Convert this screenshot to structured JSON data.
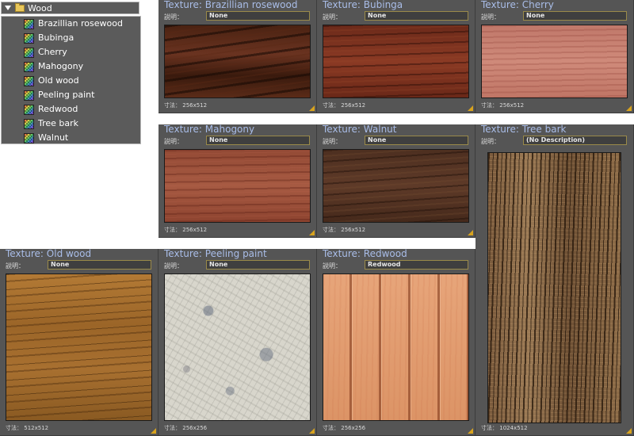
{
  "inventory": {
    "folder_label": "Wood",
    "items": [
      {
        "label": "Brazillian rosewood"
      },
      {
        "label": "Bubinga"
      },
      {
        "label": "Cherry"
      },
      {
        "label": "Mahogony"
      },
      {
        "label": "Old wood"
      },
      {
        "label": "Peeling paint"
      },
      {
        "label": "Redwood"
      },
      {
        "label": "Tree bark"
      },
      {
        "label": "Walnut"
      }
    ]
  },
  "desc_label": "説明：",
  "size_label": "寸法：",
  "panels": [
    {
      "title": "Texture: Brazillian rosewood",
      "description": "None",
      "size": "256x512"
    },
    {
      "title": "Texture: Bubinga",
      "description": "None",
      "size": "256x512"
    },
    {
      "title": "Texture: Cherry",
      "description": "None",
      "size": "256x512"
    },
    {
      "title": "Texture: Mahogony",
      "description": "None",
      "size": "256x512"
    },
    {
      "title": "Texture: Walnut",
      "description": "None",
      "size": "256x512"
    },
    {
      "title": "Texture: Tree bark",
      "description": "(No Description)",
      "size": "1024x512"
    },
    {
      "title": "Texture: Old wood",
      "description": "None",
      "size": "512x512"
    },
    {
      "title": "Texture: Peeling paint",
      "description": "None",
      "size": "256x256"
    },
    {
      "title": "Texture: Redwood",
      "description": "Redwood",
      "size": "256x256"
    }
  ]
}
